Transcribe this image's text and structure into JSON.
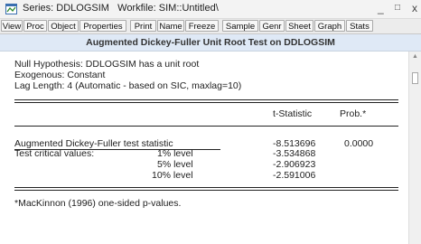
{
  "window": {
    "title": "Series: DDLOGSIM   Workfile: SIM::Untitled\\",
    "minimize": "_",
    "maximize": "□",
    "close": "x"
  },
  "toolbar": [
    "View",
    "Proc",
    "Object",
    "Properties",
    "Print",
    "Name",
    "Freeze",
    "Sample",
    "Genr",
    "Sheet",
    "Graph",
    "Stats"
  ],
  "header": "Augmented Dickey-Fuller Unit Root Test on DDLOGSIM",
  "output": {
    "null_hypothesis": "Null Hypothesis: DDLOGSIM has a unit root",
    "exogenous": "Exogenous: Constant",
    "lag_length": "Lag Length: 4 (Automatic - based on SIC, maxlag=10)",
    "col_tstat": "t-Statistic",
    "col_prob": "Prob.*",
    "adf_label": "Augmented Dickey-Fuller test statistic",
    "adf_tstat": "-8.513696",
    "adf_prob": "0.0000",
    "critical_label": "Test critical values:",
    "critical": [
      {
        "level": "1% level",
        "value": "-3.534868"
      },
      {
        "level": "5% level",
        "value": "-2.906923"
      },
      {
        "level": "10% level",
        "value": "-2.591006"
      }
    ],
    "footnote": "*MacKinnon (1996) one-sided p-values."
  }
}
